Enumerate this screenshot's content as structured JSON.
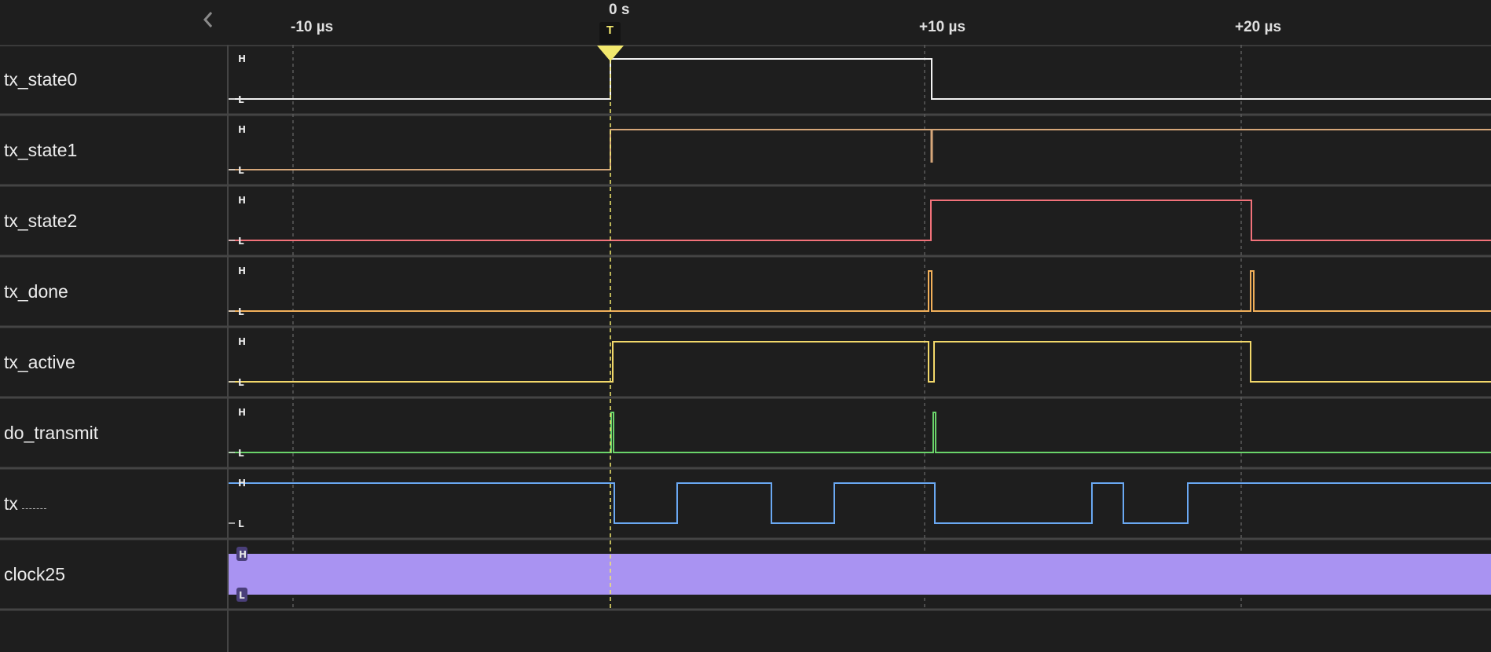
{
  "timeline": {
    "zero_label": "0 s",
    "trigger_label": "T",
    "ticks": [
      "-10 µs",
      "+10 µs",
      "+20 µs"
    ]
  },
  "level_labels": {
    "high": "H",
    "low": "L"
  },
  "signals": [
    {
      "name": "tx_state0",
      "color": "#f2f2f2"
    },
    {
      "name": "tx_state1",
      "color": "#d6a77a"
    },
    {
      "name": "tx_state2",
      "color": "#f2727a"
    },
    {
      "name": "tx_done",
      "color": "#f2b05a"
    },
    {
      "name": "tx_active",
      "color": "#f2d86a"
    },
    {
      "name": "do_transmit",
      "color": "#6ad46a"
    },
    {
      "name": "tx",
      "color": "#6aa8f2"
    },
    {
      "name": "clock25",
      "color": "#a993f2"
    }
  ],
  "colors": {
    "background": "#1e1e1e",
    "separator": "#444444",
    "trigger": "#f2e86d",
    "gridline": "#555555"
  },
  "icons": {
    "collapse": "chevron-left-icon"
  }
}
